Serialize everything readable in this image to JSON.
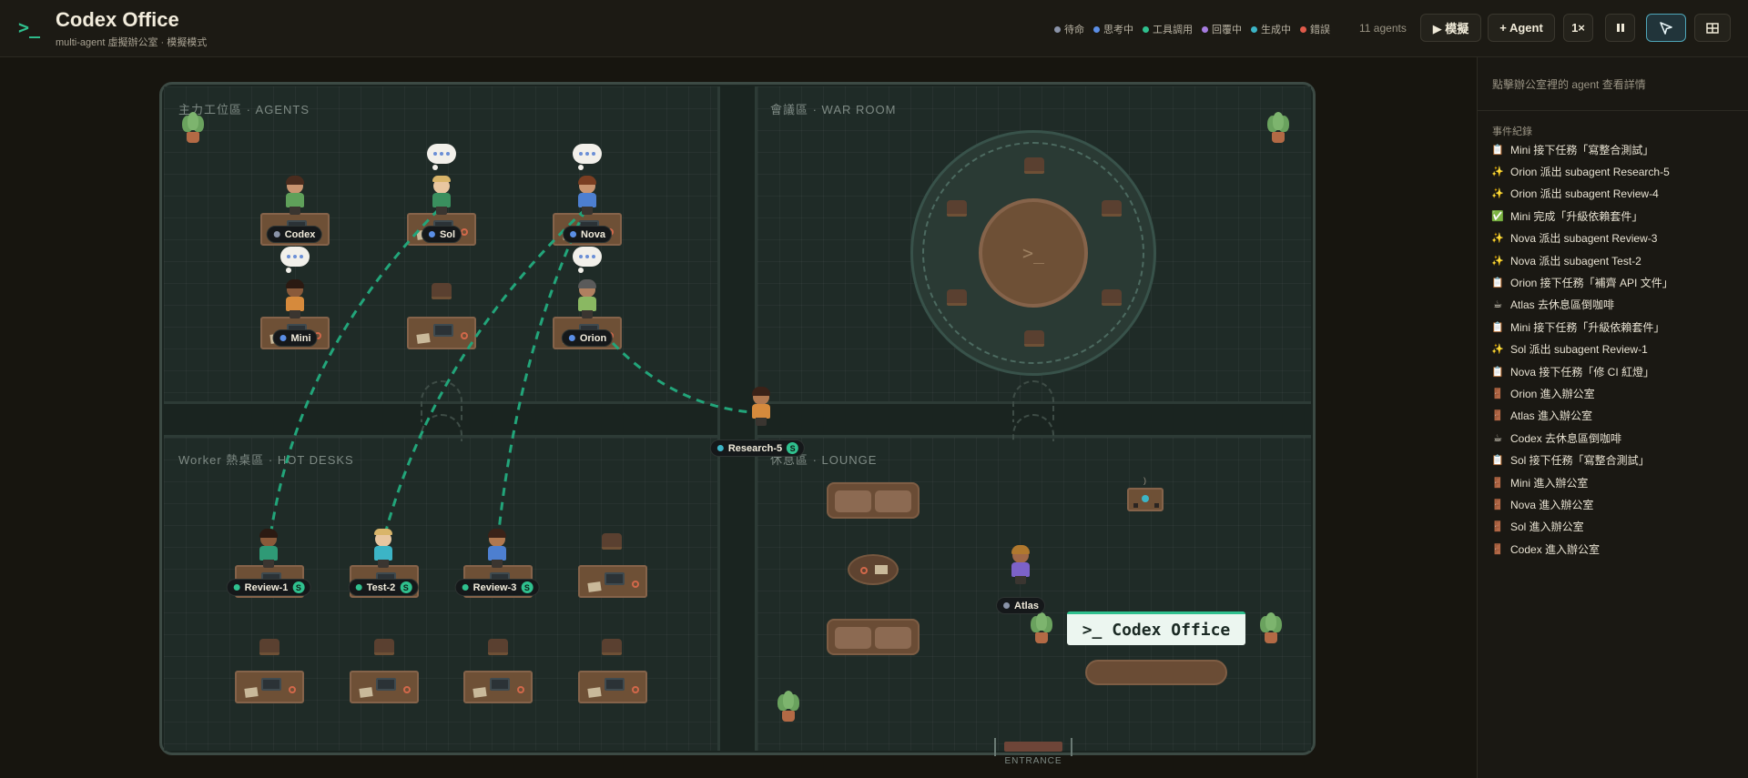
{
  "app": {
    "logo": ">_",
    "title": "Codex Office",
    "subtitle": "multi-agent 虛擬辦公室 · 模擬模式"
  },
  "legend": [
    {
      "label": "待命",
      "color": "#8a93a8"
    },
    {
      "label": "思考中",
      "color": "#5b8ee6"
    },
    {
      "label": "工具調用",
      "color": "#2fc08e"
    },
    {
      "label": "回覆中",
      "color": "#a67ce0"
    },
    {
      "label": "生成中",
      "color": "#3cb4c6"
    },
    {
      "label": "錯誤",
      "color": "#e05a4a"
    }
  ],
  "agent_count": "11 agents",
  "controls": {
    "simulate": "▶ 模擬",
    "add_agent": "+ Agent",
    "speed": "1×",
    "pause": "⏸",
    "select": "",
    "layout": "⊞"
  },
  "zones": {
    "agents": "主力工位區 · AGENTS",
    "war_room": "會議區 · WAR ROOM",
    "hot_desks": "Worker 熱桌區 · HOT DESKS",
    "lounge": "休息區 · LOUNGE",
    "entrance": "ENTRANCE"
  },
  "war_room_table": ">_",
  "sign": ">_ Codex Office",
  "agents": [
    {
      "name": "Codex",
      "status_color": "#8a93a8",
      "sub": false
    },
    {
      "name": "Sol",
      "status_color": "#5b8ee6",
      "sub": false
    },
    {
      "name": "Nova",
      "status_color": "#5b8ee6",
      "sub": false
    },
    {
      "name": "Mini",
      "status_color": "#5b8ee6",
      "sub": false
    },
    {
      "name": "Orion",
      "status_color": "#5b8ee6",
      "sub": false
    },
    {
      "name": "Research-5",
      "status_color": "#3cb4c6",
      "sub": true
    },
    {
      "name": "Review-1",
      "status_color": "#2fc08e",
      "sub": true
    },
    {
      "name": "Test-2",
      "status_color": "#2fc08e",
      "sub": true
    },
    {
      "name": "Review-3",
      "status_color": "#2fc08e",
      "sub": true
    },
    {
      "name": "Atlas",
      "status_color": "#8a93a8",
      "sub": false
    }
  ],
  "sub_badge": "S",
  "panel": {
    "hint": "點擊辦公室裡的 agent 查看詳情",
    "events_title": "事件紀錄",
    "events": [
      {
        "icon": "📋",
        "text": "Mini 接下任務「寫整合測試」"
      },
      {
        "icon": "✨",
        "text": "Orion 派出 subagent Research-5"
      },
      {
        "icon": "✨",
        "text": "Orion 派出 subagent Review-4"
      },
      {
        "icon": "✅",
        "text": "Mini 完成「升級依賴套件」"
      },
      {
        "icon": "✨",
        "text": "Nova 派出 subagent Review-3"
      },
      {
        "icon": "✨",
        "text": "Nova 派出 subagent Test-2"
      },
      {
        "icon": "📋",
        "text": "Orion 接下任務「補齊 API 文件」"
      },
      {
        "icon": "☕",
        "text": "Atlas 去休息區倒咖啡"
      },
      {
        "icon": "📋",
        "text": "Mini 接下任務「升級依賴套件」"
      },
      {
        "icon": "✨",
        "text": "Sol 派出 subagent Review-1"
      },
      {
        "icon": "📋",
        "text": "Nova 接下任務「修 CI 紅燈」"
      },
      {
        "icon": "🚪",
        "text": "Orion 進入辦公室"
      },
      {
        "icon": "🚪",
        "text": "Atlas 進入辦公室"
      },
      {
        "icon": "☕",
        "text": "Codex 去休息區倒咖啡"
      },
      {
        "icon": "📋",
        "text": "Sol 接下任務「寫整合測試」"
      },
      {
        "icon": "🚪",
        "text": "Mini 進入辦公室"
      },
      {
        "icon": "🚪",
        "text": "Nova 進入辦公室"
      },
      {
        "icon": "🚪",
        "text": "Sol 進入辦公室"
      },
      {
        "icon": "🚪",
        "text": "Codex 進入辦公室"
      }
    ]
  }
}
